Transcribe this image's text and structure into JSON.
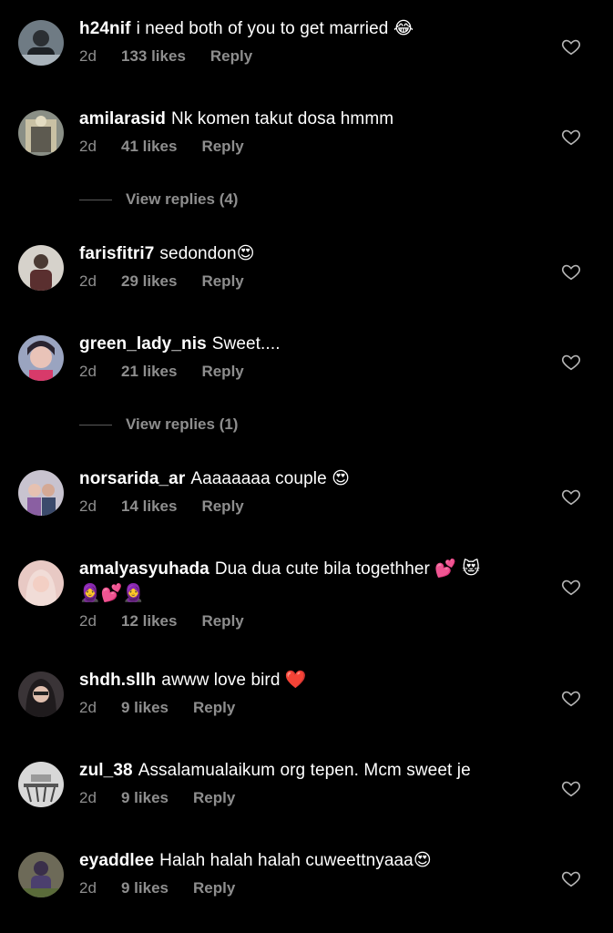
{
  "colors": {
    "background": "#000000",
    "text": "#ffffff",
    "meta": "#8e8e8e",
    "heart_outline": "#b5b5b5"
  },
  "comments": [
    {
      "username": "h24nif",
      "text": "i need both of you to get married",
      "emoji": "😂",
      "time": "2d",
      "likes": "133 likes",
      "reply": "Reply",
      "avatar_color": "#6f7b84"
    },
    {
      "username": "amilarasid",
      "text": "Nk komen takut dosa hmmm",
      "emoji": "",
      "time": "2d",
      "likes": "41 likes",
      "reply": "Reply",
      "avatar_color": "#8a8f86"
    },
    {
      "username": "farisfitri7",
      "text": "sedondon",
      "emoji": "😍",
      "time": "2d",
      "likes": "29 likes",
      "reply": "Reply",
      "avatar_color": "#b9b3a8"
    },
    {
      "username": "green_lady_nis",
      "text": "Sweet....",
      "emoji": "",
      "time": "2d",
      "likes": "21 likes",
      "reply": "Reply",
      "avatar_color": "#9aa4c0"
    },
    {
      "username": "norsarida_ar",
      "text": "Aaaaaaaa couple",
      "emoji": "😍",
      "time": "2d",
      "likes": "14 likes",
      "reply": "Reply",
      "avatar_color": "#c8c3cf"
    },
    {
      "username": "amalyasyuhada",
      "text": "Dua dua cute bila togethher",
      "emoji": "💕 😻",
      "emoji_line2": "🧕💕🧕",
      "time": "2d",
      "likes": "12 likes",
      "reply": "Reply",
      "avatar_color": "#e8c9c4"
    },
    {
      "username": "shdh.sllh",
      "text": "awww love bird",
      "emoji": "❤️",
      "time": "2d",
      "likes": "9 likes",
      "reply": "Reply",
      "avatar_color": "#3a3437"
    },
    {
      "username": "zul_38",
      "text": "Assalamualaikum org tepen. Mcm sweet je",
      "emoji": "",
      "time": "2d",
      "likes": "9 likes",
      "reply": "Reply",
      "avatar_color": "#d8d8d8"
    },
    {
      "username": "eyaddlee",
      "text": "Halah halah halah cuweettnyaaa",
      "emoji": "😍",
      "time": "2d",
      "likes": "9 likes",
      "reply": "Reply",
      "avatar_color": "#6d6a58"
    }
  ],
  "view_replies": [
    {
      "label": "View replies (4)"
    },
    {
      "label": "View replies (1)"
    }
  ]
}
